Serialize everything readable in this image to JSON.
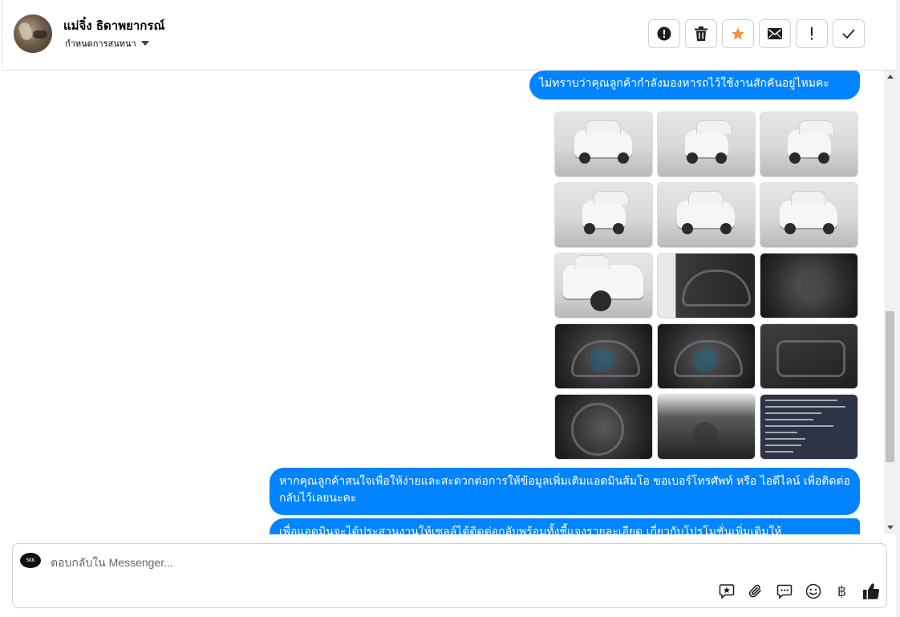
{
  "header": {
    "contact_name": "แม่จิ๋ง ธิดาพยากรณ์",
    "status_label": "กำหนดการสนทนา",
    "toolbar": [
      {
        "name": "report-spam-button",
        "icon": "alert-circle-icon"
      },
      {
        "name": "delete-button",
        "icon": "trash-icon"
      },
      {
        "name": "star-button",
        "icon": "star-icon",
        "color": "#f7923a"
      },
      {
        "name": "mark-unread-button",
        "icon": "envelope-icon"
      },
      {
        "name": "follow-up-button",
        "icon": "exclamation-icon"
      },
      {
        "name": "mark-done-button",
        "icon": "checkmark-icon"
      }
    ]
  },
  "messages": [
    {
      "text": "ไม่ทราบว่าคุณลูกค้ากำลังมองหารถไว้ใช้งานสักคันอยู่ไหมคะ"
    },
    {
      "type": "photos",
      "count": 15
    },
    {
      "text": "หากคุณลูกค้าสนใจเพื่อให้ง่ายและสะดวกต่อการให้ข้อมูลเพิ่มเติมแอดมินส้มโอ ขอเบอร์โทรศัพท์ หรือ ไอดีไลน์ เพื่อติดต่อกลับไว้เลยนะคะ"
    },
    {
      "text": "เพื่อแอดมินจะได้ประสานงานให้เซลล์ได้ติดต่อกลับพร้อมทั้งชี้แจงรายละเอียด เกี่ยวกับโปรโมชั่นเพิ่มเติมให้"
    }
  ],
  "composer": {
    "placeholder": "ตอบกลับใน Messenger...",
    "page_icon_text": "SKK",
    "actions": [
      "saved-reply-icon",
      "paperclip-icon",
      "chat-bubble-icon",
      "emoji-icon",
      "baht-icon",
      "thumbs-up-icon"
    ],
    "baht_symbol": "฿"
  },
  "colors": {
    "bubble": "#0084ff",
    "star": "#f7923a"
  }
}
